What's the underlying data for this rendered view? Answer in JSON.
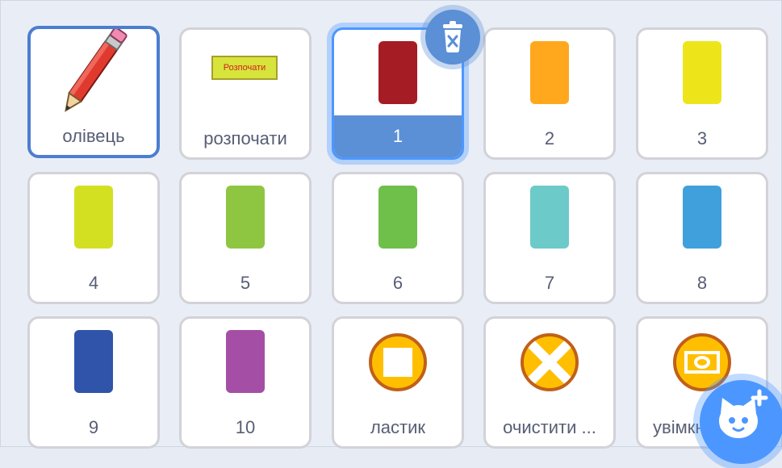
{
  "sprites": [
    {
      "name": "олівець"
    },
    {
      "name": "розпочати",
      "sign_text": "Розпочати"
    },
    {
      "name": "1",
      "color": "#a51c24"
    },
    {
      "name": "2",
      "color": "#ffa81e"
    },
    {
      "name": "3",
      "color": "#ede51a"
    },
    {
      "name": "4",
      "color": "#d3e022"
    },
    {
      "name": "5",
      "color": "#8ec641"
    },
    {
      "name": "6",
      "color": "#6fbf4b"
    },
    {
      "name": "7",
      "color": "#6ccac9"
    },
    {
      "name": "8",
      "color": "#40a0dc"
    },
    {
      "name": "9",
      "color": "#2f54aa"
    },
    {
      "name": "10",
      "color": "#a54ea5"
    },
    {
      "name": "ластик"
    },
    {
      "name": "очистити ..."
    },
    {
      "name": "увімкн"
    }
  ],
  "selected_sprite": "1",
  "colors": {
    "selection_blue": "#5b8fd6",
    "icon_orange": "#ffbf00",
    "icon_outline": "#c0601a"
  },
  "icons": {
    "delete": "trash-icon",
    "add_sprite": "cat-plus-icon",
    "eraser": "stop-square-icon",
    "clear": "x-icon",
    "camera": "camera-icon",
    "pencil": "pencil-icon"
  }
}
